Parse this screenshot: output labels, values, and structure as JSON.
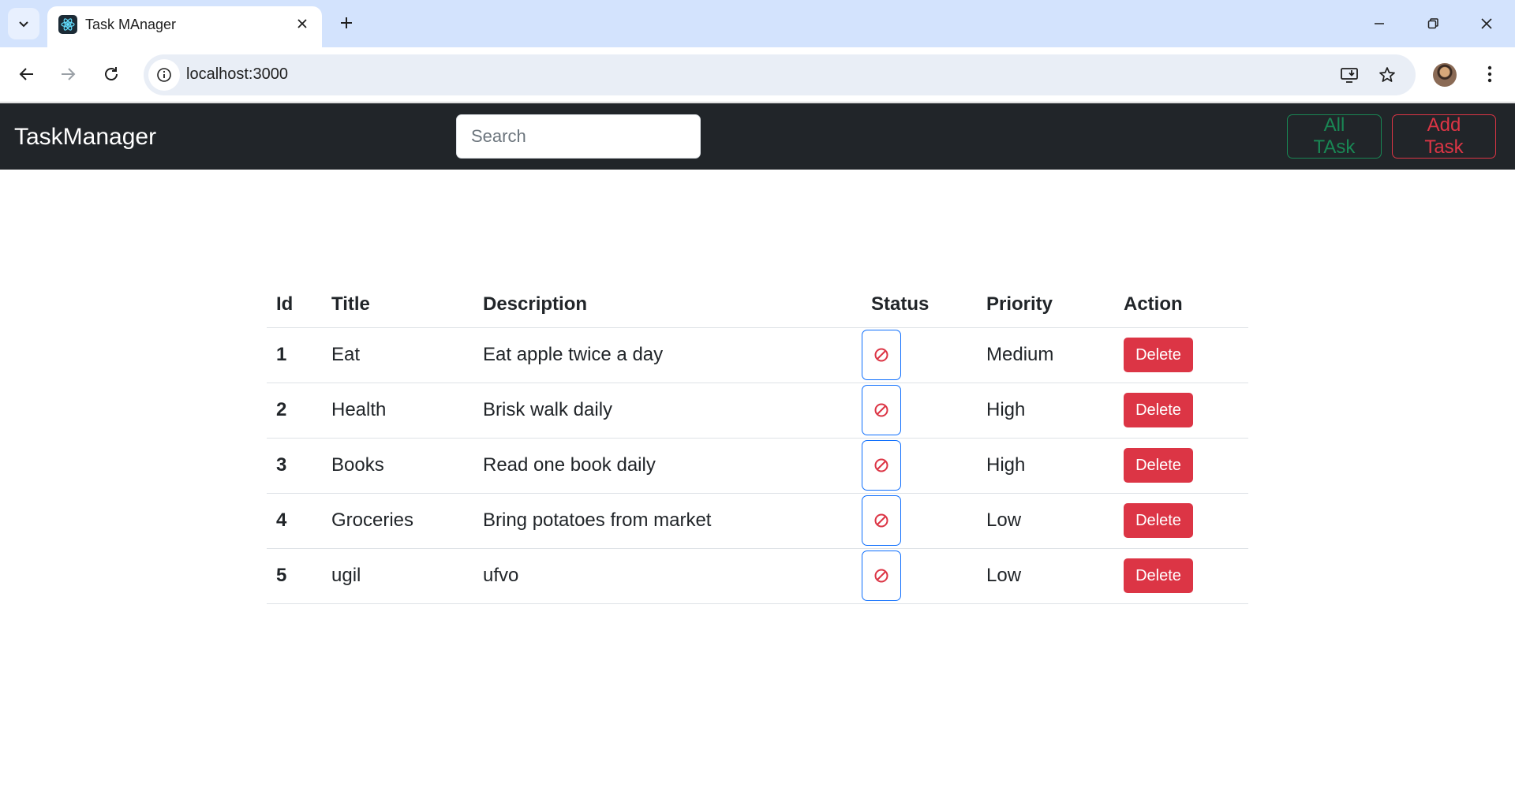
{
  "browser": {
    "tab_title": "Task MAnager",
    "url": "localhost:3000"
  },
  "navbar": {
    "brand": "TaskManager",
    "search_placeholder": "Search",
    "all_tasks_label": "All TAsk",
    "add_task_label": "Add Task"
  },
  "table": {
    "headers": {
      "id": "Id",
      "title": "Title",
      "description": "Description",
      "status": "Status",
      "priority": "Priority",
      "action": "Action"
    },
    "rows": [
      {
        "id": "1",
        "title": "Eat",
        "description": "Eat apple twice a day",
        "priority": "Medium",
        "action": "Delete"
      },
      {
        "id": "2",
        "title": "Health",
        "description": "Brisk walk daily",
        "priority": "High",
        "action": "Delete"
      },
      {
        "id": "3",
        "title": "Books",
        "description": "Read one book daily",
        "priority": "High",
        "action": "Delete"
      },
      {
        "id": "4",
        "title": "Groceries",
        "description": "Bring potatoes from market",
        "priority": "Low",
        "action": "Delete"
      },
      {
        "id": "5",
        "title": "ugil",
        "description": "ufvo",
        "priority": "Low",
        "action": "Delete"
      }
    ]
  },
  "icons": {
    "status": "not-allowed-icon"
  },
  "colors": {
    "navbar_bg": "#212529",
    "success": "#198754",
    "danger": "#dc3545",
    "primary": "#0d6efd"
  }
}
